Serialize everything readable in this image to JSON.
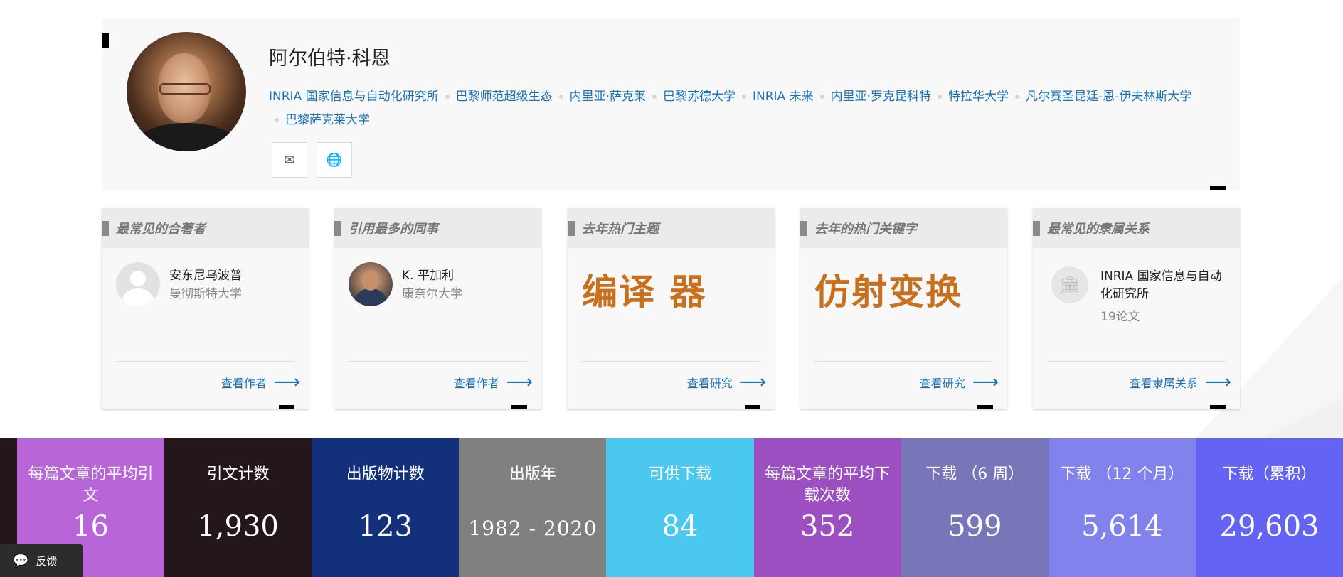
{
  "profile": {
    "name": "阿尔伯特·科恩",
    "affiliations": [
      "INRIA 国家信息与自动化研究所",
      "巴黎师范超级生态",
      "内里亚·萨克莱",
      "巴黎苏德大学",
      "INRIA 未来",
      "内里亚·罗克昆科特",
      "特拉华大学",
      "凡尔赛圣昆廷-恩-伊夫林斯大学",
      "巴黎萨克莱大学"
    ],
    "contact_icons": [
      "mail-icon",
      "globe-icon"
    ]
  },
  "cards": {
    "coauthor": {
      "title": "最常见的合著者",
      "name": "安东尼乌波普",
      "affiliation": "曼彻斯特大学",
      "link": "查看作者"
    },
    "colleague": {
      "title": "引用最多的同事",
      "name": "K. 平加利",
      "affiliation": "康奈尔大学",
      "link": "查看作者"
    },
    "topic": {
      "title": "去年热门主题",
      "value": "编译 器",
      "link": "查看研究"
    },
    "keyword": {
      "title": "去年的热门关键字",
      "value": "仿射变换",
      "link": "查看研究"
    },
    "affiliation": {
      "title": "最常见的隶属关系",
      "name": "INRIA 国家信息与自动化研究所",
      "papers": "19论文",
      "link": "查看隶属关系"
    }
  },
  "stats": [
    {
      "label": "每篇文章的平均引文",
      "value": "16",
      "color": "#b865d8"
    },
    {
      "label": "引文计数",
      "value": "1,930",
      "color": "#241719"
    },
    {
      "label": "出版物计数",
      "value": "123",
      "color": "#13307a"
    },
    {
      "label": "出版年",
      "value": "1982 - 2020",
      "color": "#808080"
    },
    {
      "label": "可供下载",
      "value": "84",
      "color": "#4bc8f0"
    },
    {
      "label": "每篇文章的平均下载次数",
      "value": "352",
      "color": "#9c4fc0"
    },
    {
      "label": "下载 （6 周）",
      "value": "599",
      "color": "#7676b8"
    },
    {
      "label": "下载 （12 个月）",
      "value": "5,614",
      "color": "#8282ec"
    },
    {
      "label": "下载（累积）",
      "value": "29,603",
      "color": "#6464f4"
    }
  ],
  "feedback": {
    "label": "反馈"
  },
  "colors": {
    "link": "#1a73b8",
    "topic": "#c8701e"
  }
}
